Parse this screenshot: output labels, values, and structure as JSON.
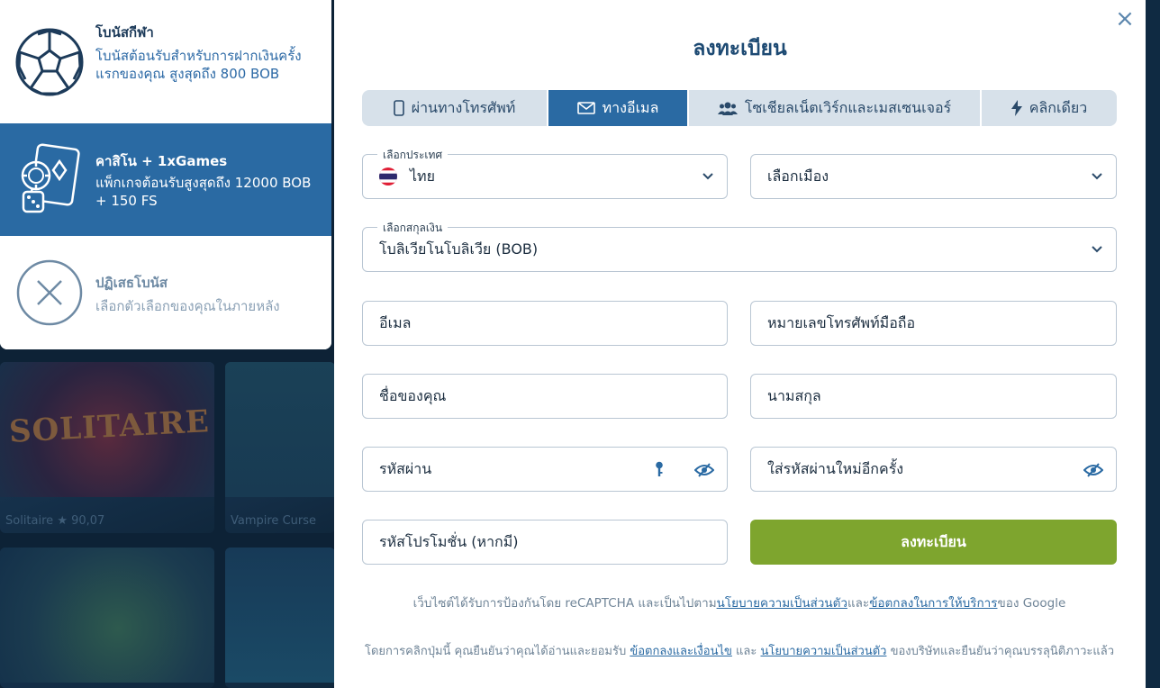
{
  "bonus": [
    {
      "title": "โบนัสกีฬา",
      "desc": "โบนัสต้อนรับสำหรับการฝากเงินครั้งแรกของคุณ สูงสุดถึง 800 BOB",
      "icon": "soccer-ball-icon"
    },
    {
      "title": "คาสิโน + 1xGames",
      "desc": "แพ็กเกจต้อนรับสูงสุดถึง 12000 BOB + 150 FS",
      "icon": "casino-chips-icon"
    },
    {
      "title": "ปฏิเสธโบนัส",
      "desc": "เลือกตัวเลือกของคุณในภายหลัง",
      "icon": "decline-x-icon"
    }
  ],
  "background_games": [
    {
      "name": "Solitaire",
      "art_text": "SOLITAIRE",
      "meta": "★ 90,07"
    },
    {
      "name": "Vampire Curse",
      "meta": ""
    },
    {
      "name": "",
      "meta": ""
    },
    {
      "name": "",
      "meta": ""
    }
  ],
  "modal": {
    "title": "ลงทะเบียน",
    "close": "×",
    "tabs": [
      {
        "label": "ผ่านทางโทรศัพท์",
        "icon": "phone-icon",
        "active": false
      },
      {
        "label": "ทางอีเมล",
        "icon": "envelope-icon",
        "active": true
      },
      {
        "label": "โซเชียลเน็ตเวิร์กและเมสเซนเจอร์",
        "icon": "users-icon",
        "active": false
      },
      {
        "label": "คลิกเดียว",
        "icon": "lightning-icon",
        "active": false
      }
    ],
    "country": {
      "legend": "เลือกประเทศ",
      "value": "ไทย"
    },
    "city": {
      "placeholder": "เลือกเมือง"
    },
    "currency": {
      "legend": "เลือกสกุลเงิน",
      "value": "โบลิเวียโนโบลิเวีย (BOB)"
    },
    "email": {
      "placeholder": "อีเมล"
    },
    "phone": {
      "placeholder": "หมายเลขโทรศัพท์มือถือ"
    },
    "first_name": {
      "placeholder": "ชื่อของคุณ"
    },
    "last_name": {
      "placeholder": "นามสกุล"
    },
    "password": {
      "placeholder": "รหัสผ่าน"
    },
    "password_repeat": {
      "placeholder": "ใส่รหัสผ่านใหม่อีกครั้ง"
    },
    "promo": {
      "placeholder": "รหัสโปรโมชั่น (หากมี)"
    },
    "submit": "ลงทะเบียน",
    "recaptcha": {
      "pre": "เว็บไซต์ได้รับการป้องกันโดย reCAPTCHA และเป็นไปตาม",
      "link1": "นโยบายความเป็นส่วนตัว",
      "mid": "และ",
      "link2": "ข้อตกลงในการให้บริการ",
      "post": "ของ Google"
    },
    "terms": {
      "pre": "โดยการคลิกปุ่มนี้ คุณยืนยันว่าคุณได้อ่านและยอมรับ ",
      "link1": "ข้อตกลงและเงื่อนไข",
      "mid": " และ ",
      "link2": "นโยบายความเป็นส่วนตัว",
      "post": " ของบริษัทและยืนยันว่าคุณบรรลุนิติภาวะแล้ว"
    }
  },
  "colors": {
    "accent": "#2a6aa3",
    "submit": "#7ea52e",
    "title": "#1d4a73"
  }
}
